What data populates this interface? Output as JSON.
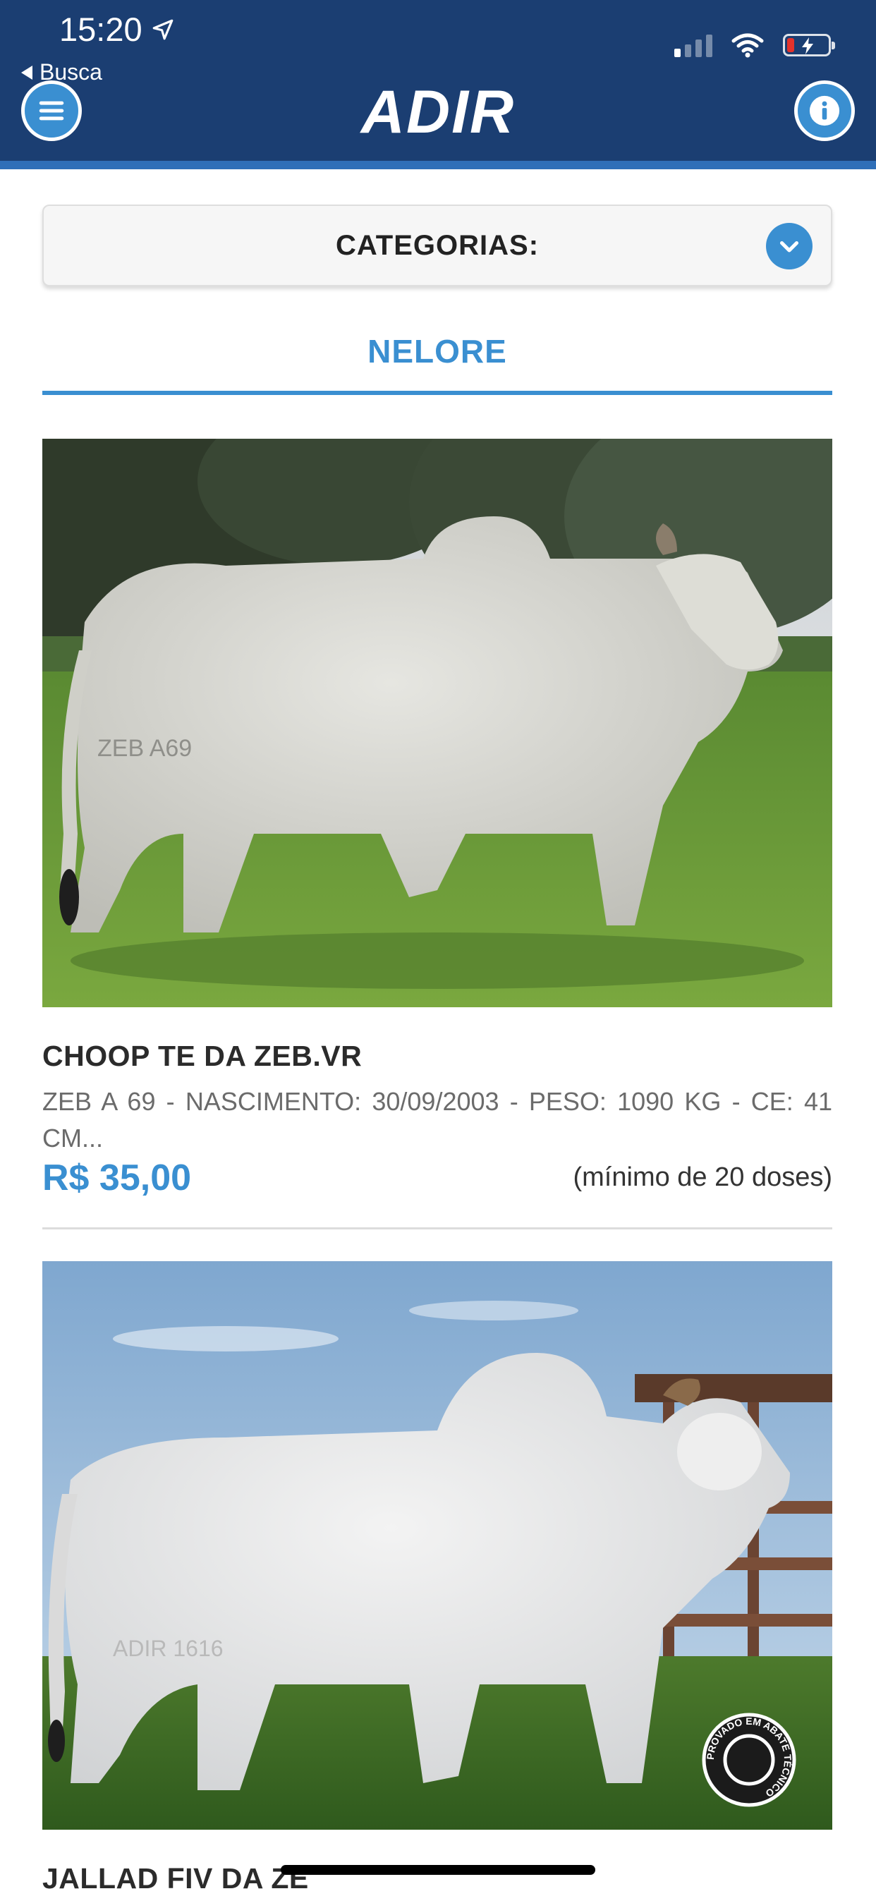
{
  "status_bar": {
    "time": "15:20",
    "back_label": "Busca"
  },
  "header": {
    "logo": "ADIR",
    "menu_icon": "hamburger-menu-icon",
    "info_icon": "info-icon",
    "bg_color": "#1b3e72",
    "accent_color": "#3a8fd1"
  },
  "categories": {
    "label": "CATEGORIAS:",
    "dropdown_icon": "chevron-down-icon"
  },
  "active_tab": "NELORE",
  "products": [
    {
      "name": "CHOOP TE DA ZEB.VR",
      "description": "ZEB A 69 - NASCIMENTO: 30/09/2003 - PESO: 1090 KG - CE: 41 CM...",
      "price": "R$ 35,00",
      "minimum": "(mínimo de 20 doses)",
      "brand_mark": "ZEB A69"
    },
    {
      "name": "JALLAD FIV DA ZE",
      "brand_mark": "ADIR 1616",
      "badge_text": "PROVADO EM ABATE TÉCNICO"
    }
  ]
}
